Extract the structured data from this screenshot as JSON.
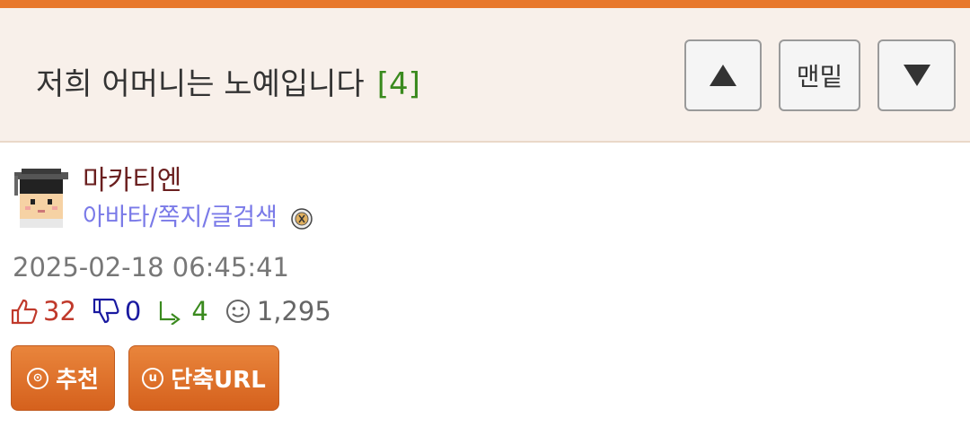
{
  "header": {
    "title": "저희 어머니는 노예입니다",
    "comment_count": "[4]",
    "up_button": "up-arrow",
    "bottom_label": "맨밑",
    "down_button": "down-arrow"
  },
  "author": {
    "name": "마카티엔",
    "links": "아바타/쪽지/글검색"
  },
  "post": {
    "date": "2025-02-18 06:45:41"
  },
  "stats": {
    "upvotes": "32",
    "downvotes": "0",
    "replies": "4",
    "views": "1,295"
  },
  "actions": {
    "recommend_label": "추천",
    "recommend_glyph": "⊙",
    "shorturl_label": "단축URL",
    "shorturl_glyph": "u"
  },
  "colors": {
    "top_bar": "#e8782c",
    "header_bg": "#f8f0ea",
    "comment_count": "#3a8a1e",
    "author": "#6a1f1f",
    "links": "#7a7ae8",
    "button_orange": "#e0732a"
  }
}
